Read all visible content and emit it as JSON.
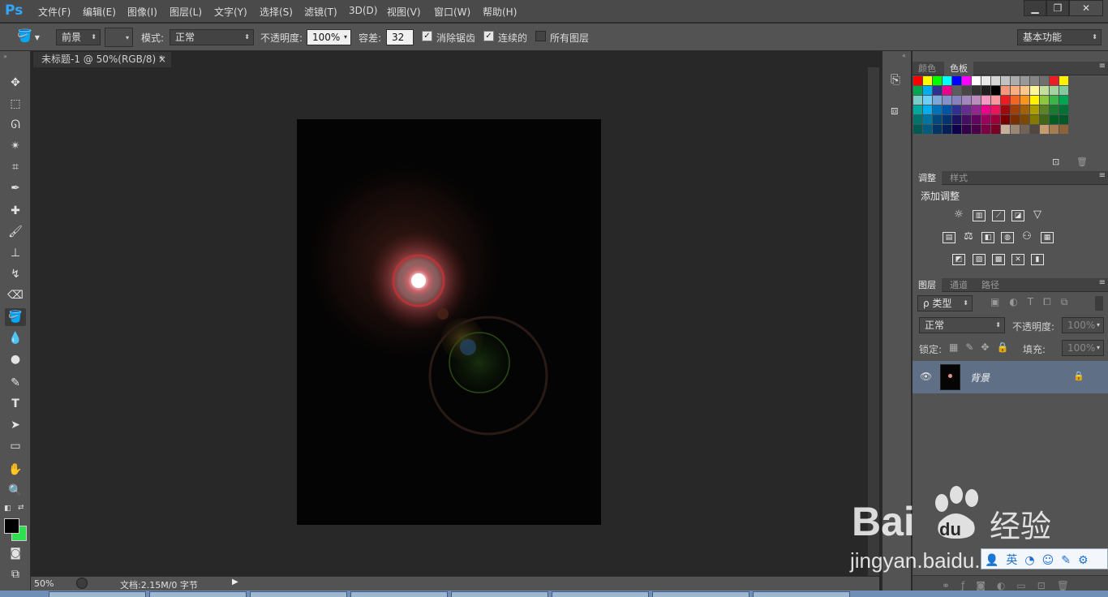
{
  "app": {
    "logo": "Ps"
  },
  "menu": [
    "文件(F)",
    "编辑(E)",
    "图像(I)",
    "图层(L)",
    "文字(Y)",
    "选择(S)",
    "滤镜(T)",
    "3D(D)",
    "视图(V)",
    "窗口(W)",
    "帮助(H)"
  ],
  "window_controls": {
    "minimize": "▁",
    "restore": "❐",
    "close": "✕"
  },
  "options": {
    "tool_icon": "paint-bucket-icon",
    "fill_source": "前景",
    "mode_label": "模式:",
    "mode_value": "正常",
    "opacity_label": "不透明度:",
    "opacity_value": "100%",
    "tolerance_label": "容差:",
    "tolerance_value": "32",
    "antialias_label": "消除锯齿",
    "antialias_checked": true,
    "contiguous_label": "连续的",
    "contiguous_checked": true,
    "all_layers_label": "所有图层",
    "all_layers_checked": false,
    "workspace": "基本功能"
  },
  "document": {
    "tab_title": "未标题-1 @ 50%(RGB/8) *",
    "tab_close": "×"
  },
  "status": {
    "zoom": "50%",
    "doc_info": "文档:2.15M/0 字节"
  },
  "panels": {
    "color_tabs": [
      "颜色",
      "色板"
    ],
    "adjust_tabs": [
      "调整",
      "样式"
    ],
    "adjust_title": "添加调整",
    "layers_tabs": [
      "图层",
      "通道",
      "路径"
    ],
    "layers_filter": "ρ 类型",
    "blend_mode": "正常",
    "opacity_label": "不透明度:",
    "opacity_value": "100%",
    "lock_label": "锁定:",
    "fill_label": "填充:",
    "fill_value": "100%",
    "layer_name": "背景"
  },
  "swatches": [
    [
      "#ff0000",
      "#ffff00",
      "#00ff00",
      "#00ffff",
      "#0000ff",
      "#ff00ff",
      "#ffffff",
      "#ebebeb",
      "#d6d6d6",
      "#c2c2c2",
      "#adadad",
      "#999999",
      "#858585",
      "#707070",
      "#ee1d24",
      "#fff100"
    ],
    [
      "#00a650",
      "#00aeef",
      "#2e3192",
      "#ec008c",
      "#5c5c5c",
      "#474747",
      "#333333",
      "#1f1f1f",
      "#000000",
      "#f7977a",
      "#f9ad81",
      "#fdc68a",
      "#fff79a",
      "#c4df9b",
      "#a3d39c",
      "#82ca9d"
    ],
    [
      "#7accc8",
      "#6dcff6",
      "#7da7d9",
      "#8393ca",
      "#8781bd",
      "#a187be",
      "#bd8cbf",
      "#f49ac2",
      "#f6989d",
      "#ed1c24",
      "#f26522",
      "#f7941d",
      "#fff200",
      "#8dc63f",
      "#39b54a",
      "#00a651"
    ],
    [
      "#00a99d",
      "#00aeef",
      "#0072bc",
      "#0054a6",
      "#2e3192",
      "#662d91",
      "#92278f",
      "#ec008c",
      "#ed145b",
      "#9e0b0f",
      "#a0410d",
      "#a36209",
      "#aba000",
      "#598527",
      "#197b30",
      "#007236"
    ],
    [
      "#00746b",
      "#0076a3",
      "#004a80",
      "#003471",
      "#1b1464",
      "#440e62",
      "#630460",
      "#9e005d",
      "#9e0039",
      "#790000",
      "#7b2e00",
      "#7d4900",
      "#827b00",
      "#406618",
      "#005e20",
      "#005826"
    ],
    [
      "#005952",
      "#005b7f",
      "#003663",
      "#002157",
      "#0d004c",
      "#32004b",
      "#4b0049",
      "#7b0046",
      "#7a0026",
      "#c7b299",
      "#998675",
      "#736357",
      "#534741",
      "#c69c6d",
      "#a67c52",
      "#8c6239"
    ]
  ],
  "watermark": {
    "brand": "Baidu",
    "suffix": "经验",
    "url": "jingyan.baidu.com"
  }
}
